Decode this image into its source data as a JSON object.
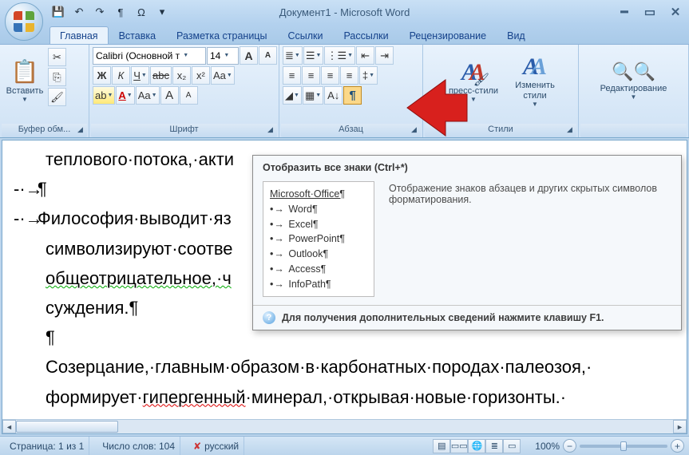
{
  "title": "Документ1 - Microsoft Word",
  "qat": {
    "save": "💾",
    "undo": "↶",
    "redo": "↷",
    "para": "¶",
    "omega": "Ω"
  },
  "tabs": [
    "Главная",
    "Вставка",
    "Разметка страницы",
    "Ссылки",
    "Рассылки",
    "Рецензирование",
    "Вид"
  ],
  "groups": {
    "clipboard": {
      "label": "Буфер обм...",
      "paste": "Вставить"
    },
    "font": {
      "label": "Шрифт",
      "name": "Calibri (Основной т",
      "size": "14",
      "bold": "Ж",
      "italic": "К",
      "underline": "Ч",
      "strike": "abc",
      "sub": "x₂",
      "sup": "x²",
      "hilite": "ab",
      "color": "A",
      "case": "Aa",
      "grow": "A",
      "shrink": "A",
      "clear": "✕"
    },
    "para": {
      "label": "Абзац"
    },
    "styles": {
      "label": "Стили",
      "quick": "пресс-стили",
      "change": "Изменить стили"
    },
    "editing": {
      "label": "Редактирование"
    }
  },
  "tooltip": {
    "title": "Отобразить все знаки (Ctrl+*)",
    "preview_header": "Microsoft·Office¶",
    "preview_items": [
      "Word¶",
      "Excel¶",
      "PowerPoint¶",
      "Outlook¶",
      "Access¶",
      "InfoPath¶"
    ],
    "desc": "Отображение знаков абзацев и других скрытых символов форматирования.",
    "footer": "Для получения дополнительных сведений нажмите клавишу F1."
  },
  "document": {
    "l1": "теплового·потока,·акти",
    "l2": "¶",
    "l3": "Философия·выводит·яз",
    "l4": "символизируют·соотве",
    "l5": "общеотрицательное,·ч",
    "l6": "суждения.¶",
    "l7": "¶",
    "l8": "Созерцание,·главным·образом·в·карбонатных·породах·палеозоя,·",
    "l9_a": "формирует·",
    "l9_b": "гипергенный",
    "l9_c": "·минерал,·открывая·новые·горизонты.·"
  },
  "status": {
    "page": "Страница: 1 из 1",
    "words": "Число слов: 104",
    "lang": "русский",
    "zoom": "100%"
  }
}
